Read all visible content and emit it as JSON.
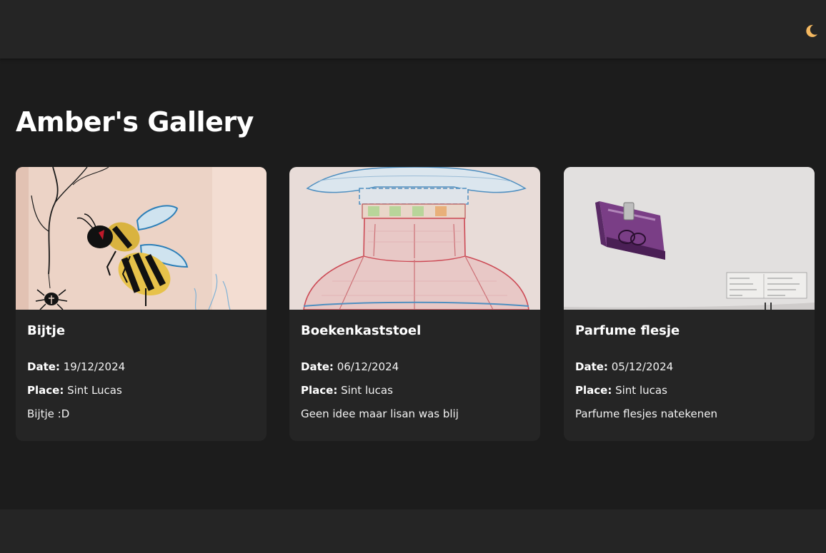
{
  "header": {
    "theme_toggle_icon": "moon-icon",
    "moon_color": "#f4b860"
  },
  "page": {
    "title": "Amber's Gallery"
  },
  "labels": {
    "date": "Date:",
    "place": "Place:"
  },
  "gallery": [
    {
      "title": "Bijtje",
      "date": "19/12/2024",
      "place": "Sint Lucas",
      "description": "Bijtje :D",
      "image_icon": "bee-drawing-image"
    },
    {
      "title": "Boekenkaststoel",
      "date": "06/12/2024",
      "place": "Sint lucas",
      "description": "Geen idee maar lisan was blij",
      "image_icon": "lamp-drawing-image"
    },
    {
      "title": "Parfume flesje",
      "date": "05/12/2024",
      "place": "Sint lucas",
      "description": "Parfume flesjes natekenen",
      "image_icon": "perfume-bottle-drawing-image"
    }
  ]
}
